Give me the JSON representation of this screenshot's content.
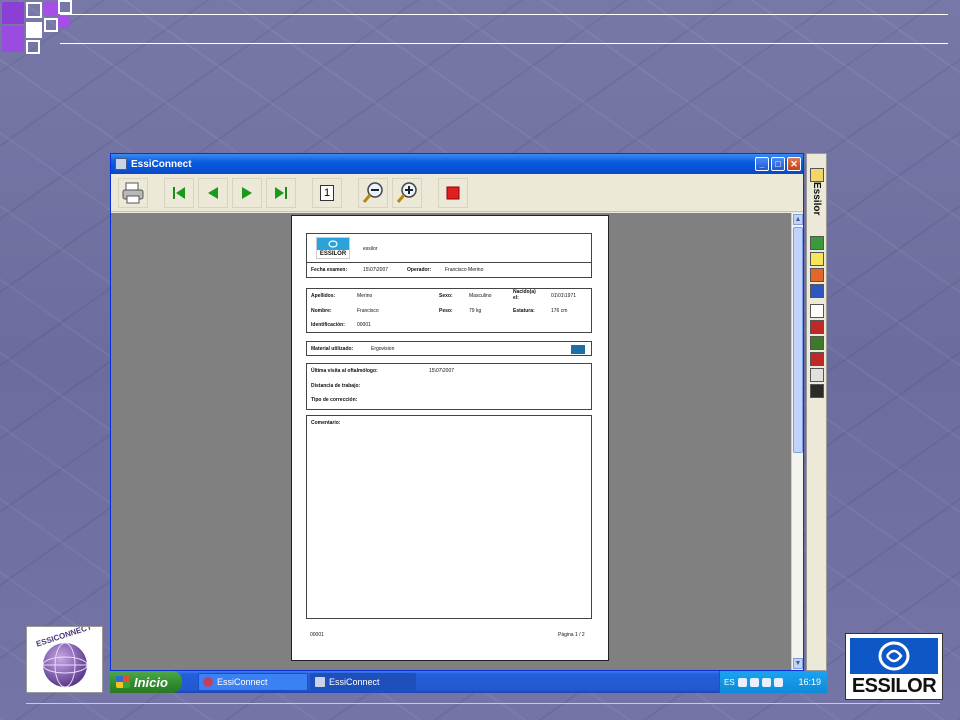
{
  "window": {
    "title": "EssiConnect"
  },
  "toolbar": {
    "page_number": "1"
  },
  "report": {
    "company_name": "essilor",
    "logo_text": "ESSILOR",
    "exam_date_label": "Fecha examen:",
    "exam_date_value": "15\\07\\2007",
    "operator_label": "Operador:",
    "operator_value": "Francisco Merino",
    "surname_label": "Apellidos:",
    "surname_value": "Merino",
    "sex_label": "Sexo:",
    "sex_value": "Masculino",
    "born_label_1": "Nacido(a)",
    "born_label_2": "el:",
    "born_value": "01\\01\\1971",
    "name_label": "Nombre:",
    "name_value": "Francisco",
    "weight_label": "Peso:",
    "weight_value": "79 kg",
    "height_label": "Estatura:",
    "height_value": "176 cm",
    "id_label": "Identificación:",
    "id_value": "00001",
    "material_label": "Material utilizado:",
    "material_value": "Ergovision",
    "last_visit_label": "Última visita al oftalmólogo:",
    "last_visit_value": "15\\07\\2007",
    "work_distance_label": "Distancia de trabajo:",
    "correction_label": "Tipo de corrección:",
    "comment_label": "Comentario:",
    "footer_id": "00001",
    "footer_page": "Página 1 / 2"
  },
  "side_toolbar": {
    "brand": "Essilor"
  },
  "taskbar": {
    "start_label": "Inicio",
    "items": [
      "EssiConnect",
      "EssiConnect"
    ],
    "language": "ES",
    "clock": "16:19"
  },
  "logos": {
    "essiconnect": "ESSICONNECT",
    "essilor": "ESSILOR"
  }
}
